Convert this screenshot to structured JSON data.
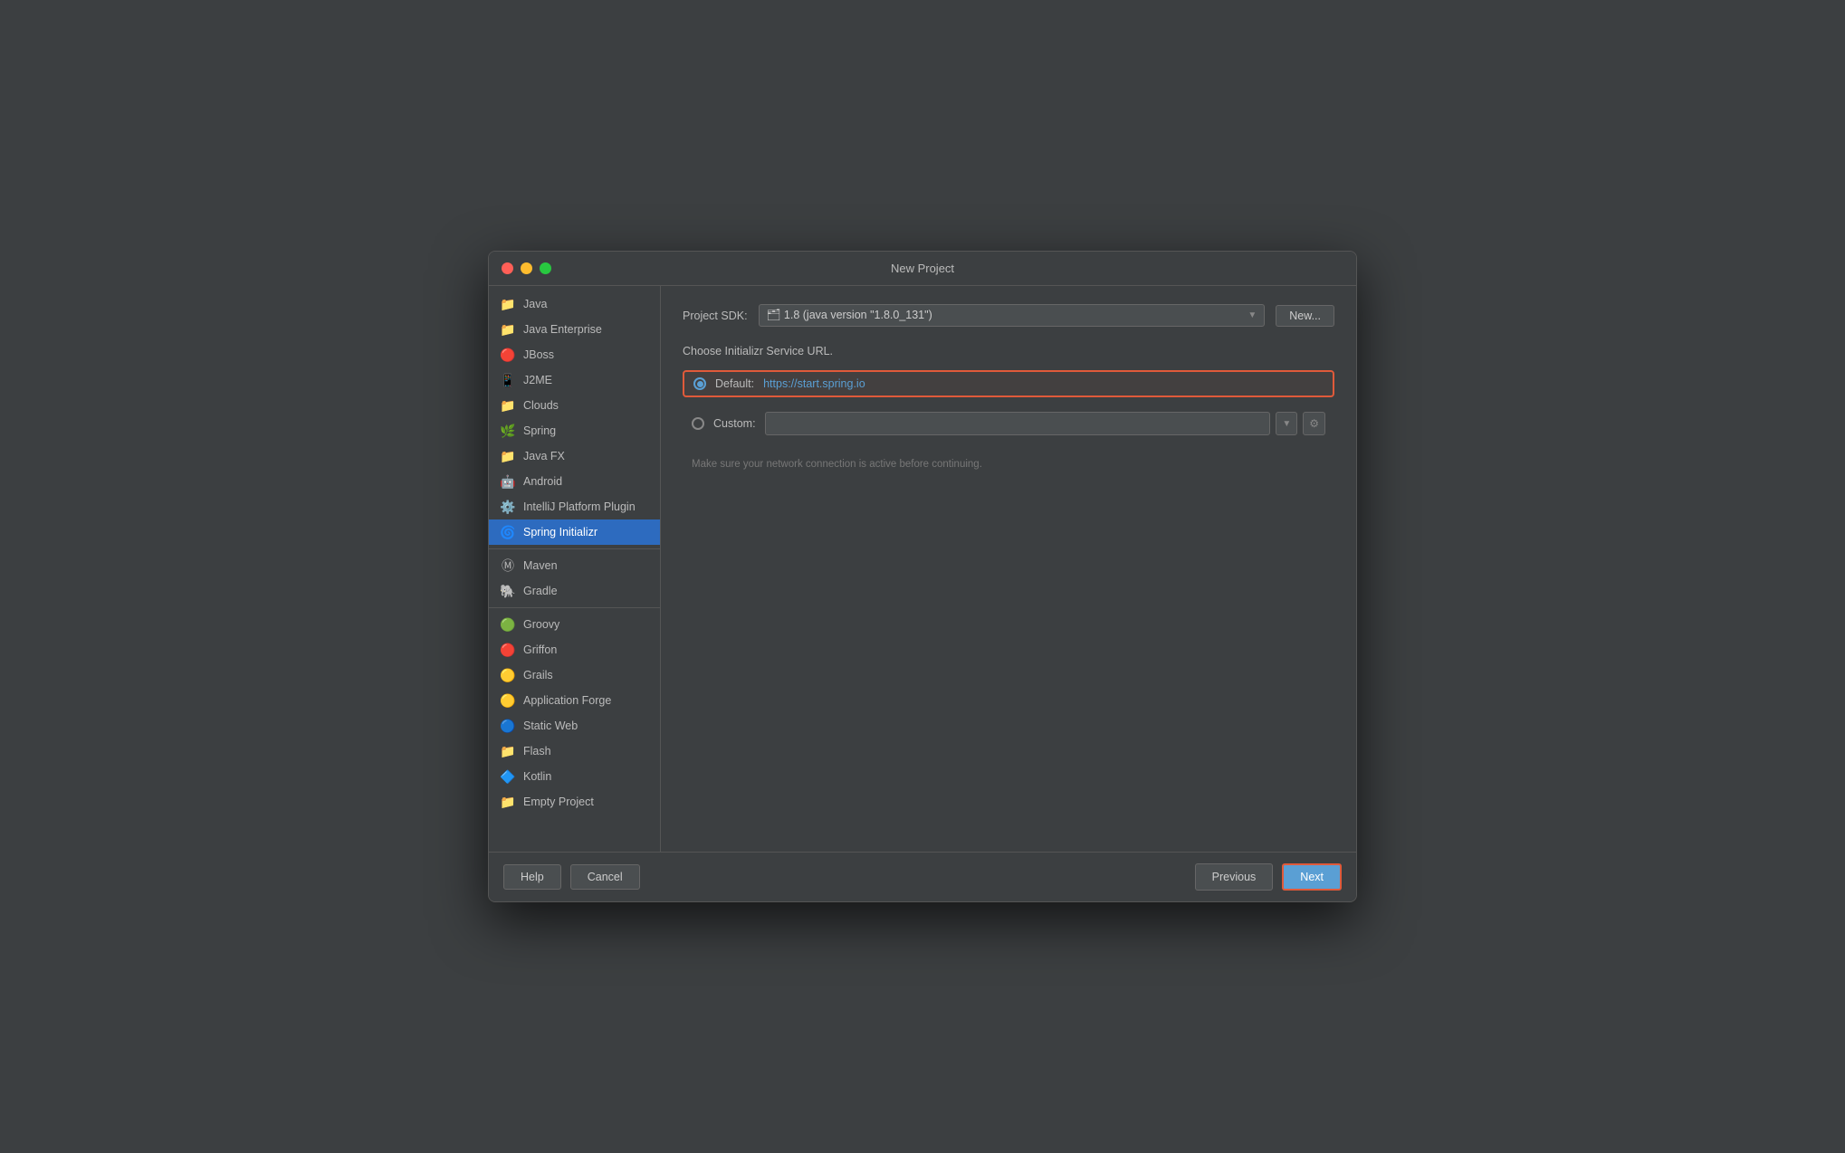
{
  "window": {
    "title": "New Project"
  },
  "titlebar": {
    "close_label": "×",
    "min_label": "−",
    "max_label": "+"
  },
  "sidebar": {
    "items": [
      {
        "id": "java",
        "label": "Java",
        "icon": "📁",
        "selected": false
      },
      {
        "id": "java-enterprise",
        "label": "Java Enterprise",
        "icon": "📁",
        "selected": false
      },
      {
        "id": "jboss",
        "label": "JBoss",
        "icon": "🔴",
        "selected": false
      },
      {
        "id": "j2me",
        "label": "J2ME",
        "icon": "📱",
        "selected": false
      },
      {
        "id": "clouds",
        "label": "Clouds",
        "icon": "📁",
        "selected": false
      },
      {
        "id": "spring",
        "label": "Spring",
        "icon": "🌿",
        "selected": false
      },
      {
        "id": "java-fx",
        "label": "Java FX",
        "icon": "📁",
        "selected": false
      },
      {
        "id": "android",
        "label": "Android",
        "icon": "🤖",
        "selected": false
      },
      {
        "id": "intellij-platform",
        "label": "IntelliJ Platform Plugin",
        "icon": "⚙️",
        "selected": false
      },
      {
        "id": "spring-initializr",
        "label": "Spring Initializr",
        "icon": "🌀",
        "selected": true
      },
      {
        "id": "maven",
        "label": "Maven",
        "icon": "Ⓜ️",
        "selected": false
      },
      {
        "id": "gradle",
        "label": "Gradle",
        "icon": "🐘",
        "selected": false
      },
      {
        "id": "groovy",
        "label": "Groovy",
        "icon": "🟢",
        "selected": false
      },
      {
        "id": "griffon",
        "label": "Griffon",
        "icon": "🔴",
        "selected": false
      },
      {
        "id": "grails",
        "label": "Grails",
        "icon": "🟡",
        "selected": false
      },
      {
        "id": "application-forge",
        "label": "Application Forge",
        "icon": "🟡",
        "selected": false
      },
      {
        "id": "static-web",
        "label": "Static Web",
        "icon": "🔵",
        "selected": false
      },
      {
        "id": "flash",
        "label": "Flash",
        "icon": "📁",
        "selected": false
      },
      {
        "id": "kotlin",
        "label": "Kotlin",
        "icon": "🔷",
        "selected": false
      },
      {
        "id": "empty-project",
        "label": "Empty Project",
        "icon": "📁",
        "selected": false
      }
    ]
  },
  "content": {
    "sdk_label": "Project SDK:",
    "sdk_value": "🗂 1.8 (java version \"1.8.0_131\")",
    "sdk_new_btn": "New...",
    "section_title": "Choose Initializr Service URL.",
    "default_label": "Default:",
    "default_url": "https://start.spring.io",
    "custom_label": "Custom:",
    "hint": "Make sure your network connection is active before continuing."
  },
  "footer": {
    "help_label": "Help",
    "cancel_label": "Cancel",
    "previous_label": "Previous",
    "next_label": "Next"
  }
}
